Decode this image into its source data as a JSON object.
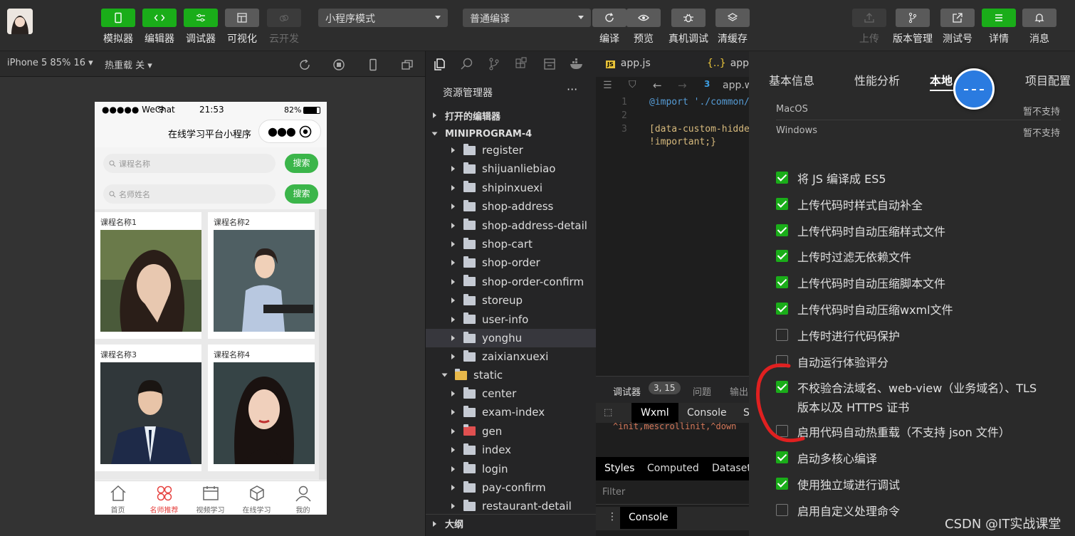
{
  "toolbar": {
    "buttons": [
      {
        "label": "模拟器"
      },
      {
        "label": "编辑器"
      },
      {
        "label": "调试器"
      },
      {
        "label": "可视化"
      },
      {
        "label": "云开发"
      }
    ],
    "mode_select": "小程序模式",
    "compile_select": "普通编译",
    "actions": [
      {
        "label": "编译"
      },
      {
        "label": "预览"
      },
      {
        "label": "真机调试"
      },
      {
        "label": "清缓存"
      }
    ],
    "right": [
      {
        "label": "上传"
      },
      {
        "label": "版本管理"
      },
      {
        "label": "测试号"
      },
      {
        "label": "详情"
      },
      {
        "label": "消息"
      }
    ]
  },
  "simulator": {
    "device": "iPhone 5 85% 16",
    "hot_reload": "热重载 关",
    "status": {
      "carrier": "●●●●● WeChat",
      "time": "21:53",
      "battery": "82%"
    },
    "nav_title": "在线学习平台小程序",
    "searches": [
      {
        "placeholder": "课程名称",
        "button": "搜索"
      },
      {
        "placeholder": "名师姓名",
        "button": "搜索"
      }
    ],
    "cards": [
      {
        "title": "课程名称1"
      },
      {
        "title": "课程名称2"
      },
      {
        "title": "课程名称3"
      },
      {
        "title": "课程名称4"
      }
    ],
    "tabs": [
      {
        "label": "首页"
      },
      {
        "label": "名师推荐"
      },
      {
        "label": "视频学习"
      },
      {
        "label": "在线学习"
      },
      {
        "label": "我的"
      }
    ],
    "active_tab": "名师推荐"
  },
  "explorer": {
    "title": "资源管理器",
    "more": "···",
    "sections": {
      "open_editors": "打开的编辑器",
      "project": "MINIPROGRAM-4",
      "outline": "大纲"
    },
    "folders": [
      "register",
      "shijuanliebiao",
      "shipinxuexi",
      "shop-address",
      "shop-address-detail",
      "shop-cart",
      "shop-order",
      "shop-order-confirm",
      "storeup",
      "user-info",
      "yonghu",
      "zaixianxuexi"
    ],
    "static_folder": "static",
    "static_children": [
      "center",
      "exam-index",
      "gen",
      "index",
      "login",
      "pay-confirm",
      "restaurant-detail"
    ],
    "selected": "yonghu"
  },
  "editor": {
    "tabs": [
      {
        "label": "app.js"
      },
      {
        "label": "app.j"
      }
    ],
    "breadcrumb": "app.w",
    "lines": [
      {
        "n": "1",
        "code": "@import './common/"
      },
      {
        "n": "2",
        "code": ""
      },
      {
        "n": "3",
        "code": "[data-custom-hidde"
      },
      {
        "n": "",
        "code": "!important;}"
      }
    ],
    "debugger": {
      "label": "调试器",
      "count": "3, 15",
      "tabs": [
        "问题",
        "输出"
      ]
    },
    "devtabs": [
      "Wxml",
      "Console",
      "S"
    ],
    "snippet": "^init,mescrollinit,^down",
    "styletabs": [
      "Styles",
      "Computed",
      "Dataset"
    ],
    "filter": "Filter",
    "console": "Console"
  },
  "settings": {
    "tabs": [
      "基本信息",
      "性能分析",
      "本地",
      "项目配置"
    ],
    "rows": [
      {
        "name": "MacOS",
        "value": "暂不支持"
      },
      {
        "name": "Windows",
        "value": "暂不支持"
      }
    ],
    "checks": [
      {
        "label": "将 JS 编译成 ES5",
        "checked": true
      },
      {
        "label": "上传代码时样式自动补全",
        "checked": true
      },
      {
        "label": "上传代码时自动压缩样式文件",
        "checked": true
      },
      {
        "label": "上传时过滤无依赖文件",
        "checked": true
      },
      {
        "label": "上传代码时自动压缩脚本文件",
        "checked": true
      },
      {
        "label": "上传代码时自动压缩wxml文件",
        "checked": true
      },
      {
        "label": "上传时进行代码保护",
        "checked": false
      },
      {
        "label": "自动运行体验评分",
        "checked": false
      },
      {
        "label": "不校验合法域名、web-view（业务域名）、TLS",
        "label2": "版本以及 HTTPS 证书",
        "checked": true
      },
      {
        "label": "启用代码自动热重载（不支持 json 文件）",
        "checked": false
      },
      {
        "label": "启动多核心编译",
        "checked": true
      },
      {
        "label": "使用独立域进行调试",
        "checked": true
      },
      {
        "label": "启用自定义处理命令",
        "checked": false
      }
    ]
  },
  "watermark": "CSDN @IT实战课堂",
  "colors": {
    "accent": "#1aad19",
    "annotation": "#e02020",
    "link": "#1e90ff"
  }
}
